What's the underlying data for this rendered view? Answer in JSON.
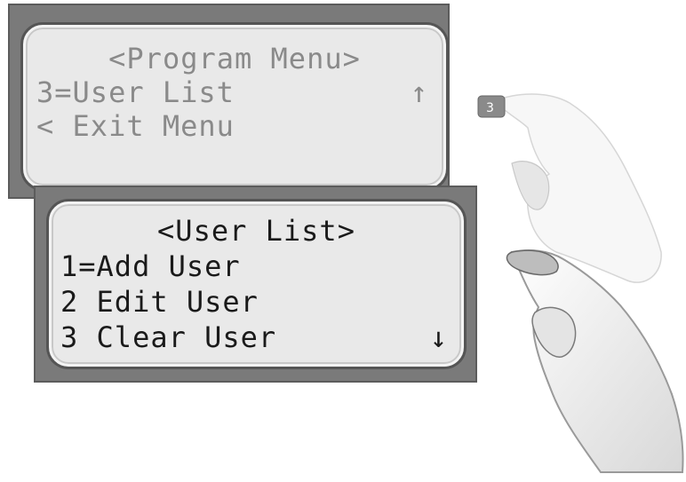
{
  "program_menu": {
    "title": "<Program Menu>",
    "item": "3=User List",
    "scroll_indicator": "↑",
    "exit": "< Exit Menu"
  },
  "user_list": {
    "title": "<User List>",
    "items": [
      "1=Add User",
      "2 Edit User",
      "3 Clear User"
    ],
    "scroll_indicator": "↓"
  },
  "key": {
    "label": "3"
  },
  "icons": {
    "hand": "pressing-hand-icon",
    "key": "keypad-key-icon"
  },
  "colors": {
    "bezel": "#7a7a7a",
    "screen": "#e9e9e9",
    "dim_text": "#8a8a8a",
    "text": "#1a1a1a"
  }
}
